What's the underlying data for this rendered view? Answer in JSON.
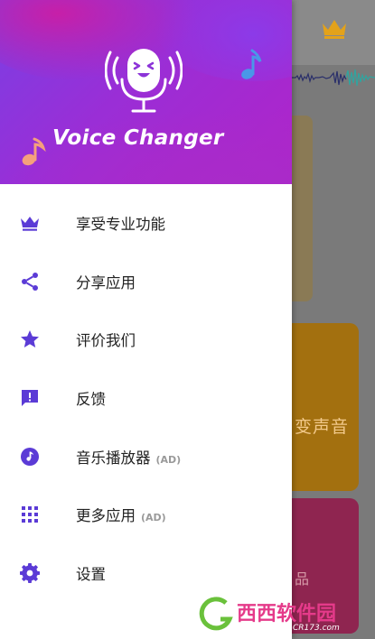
{
  "app": {
    "title": "Voice Changer",
    "accent_color": "#5b3bd6",
    "header_gradient": [
      "#7a3fe4",
      "#b024c9"
    ]
  },
  "drawer": {
    "items": [
      {
        "label": "享受专业功能",
        "icon": "crown-icon",
        "ad": ""
      },
      {
        "label": "分享应用",
        "icon": "share-icon",
        "ad": ""
      },
      {
        "label": "评价我们",
        "icon": "star-icon",
        "ad": ""
      },
      {
        "label": "反馈",
        "icon": "feedback-icon",
        "ad": ""
      },
      {
        "label": "音乐播放器",
        "icon": "music-note-icon",
        "ad": "(AD)"
      },
      {
        "label": "更多应用",
        "icon": "apps-grid-icon",
        "ad": "(AD)"
      },
      {
        "label": "设置",
        "icon": "settings-gear-icon",
        "ad": ""
      }
    ]
  },
  "background": {
    "orange_card_label": "变声音",
    "pink_card_label": "品"
  },
  "watermark": {
    "text": "西西软件园",
    "subtext": "CR173.com"
  }
}
